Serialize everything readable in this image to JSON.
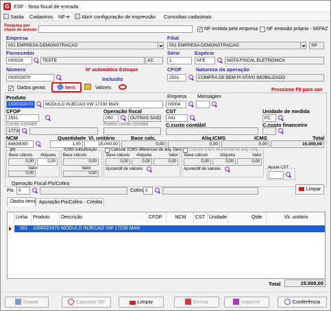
{
  "window": {
    "title": "ESF - Nota fiscal de entrada"
  },
  "menu": [
    "Saída",
    "Cadastros",
    "NF-e",
    "Abrir configuração de impressão",
    "Consultas cadastrais"
  ],
  "search": {
    "label": "Pesquisa por chave de acesso",
    "value": ""
  },
  "checks": {
    "nf_emitida_empresa": "NF emitida pela empresa",
    "nf_emissao_propria": "NF emissão própria - SEFAZ"
  },
  "empresa": {
    "label": "Empresa",
    "value": "001 EMPRESA DEMONSTRACAO"
  },
  "filial": {
    "label": "Filial",
    "value": "001 EMPRESA DEMONSTRACAO",
    "uf": "SP"
  },
  "fornecedor": {
    "label": "Fornecedor",
    "code": "000029",
    "name": "TESTE",
    "uf": "AC"
  },
  "serie": {
    "label": "Série",
    "value": "1"
  },
  "especie": {
    "label": "Espécie",
    "code": "NFE",
    "desc": "NOTA FISCAL ELETRONICA"
  },
  "numero": {
    "label": "Número",
    "value": "000003070",
    "auto_label": "Nº automático Estoque",
    "inclusao": "Inclusão"
  },
  "cfop_top": {
    "label": "CFOP",
    "value": "2551"
  },
  "natureza": {
    "label": "Natureza da operação",
    "value": "COMPRA DE BEM P/ ATIVO IMOBILIZADO"
  },
  "tabs_top": {
    "dados_gerais": "Dados gerais",
    "itens": "Itens",
    "valores": "Valores"
  },
  "hint_f8": "Pressione F8 para sair",
  "produto": {
    "label": "Produto",
    "code": "1000022470",
    "desc": "MODULO INJECAO VW 17230 MAN"
  },
  "cfop_item": {
    "label": "CFOP",
    "value": "2551"
  },
  "empresa_item": {
    "label": "Empresa",
    "value": "00004"
  },
  "mensagem": {
    "label": "Mensagem"
  },
  "operacao_fiscal": {
    "label": "Operação fiscal",
    "code": "000",
    "desc": "OUTRAS SAIDAS"
  },
  "cst": {
    "label": "CST",
    "value": "041"
  },
  "unidade": {
    "label": "Unidade de medida",
    "value": "PC"
  },
  "conta_contabil": {
    "label": "Conta contábil",
    "value": "17730"
  },
  "rateio": {
    "label": "Rateio conta contábil"
  },
  "c_custo_contabil": {
    "label": "C.custo contábil"
  },
  "c_custo_financeiro": {
    "label": "C.custo financeiro"
  },
  "ncm": {
    "label": "NCM",
    "value": "84639000"
  },
  "quantidade": {
    "label": "Quantidade",
    "value": "1,00"
  },
  "vl_unitario": {
    "label": "Vl. unitário",
    "value": "15.000,00"
  },
  "base_calc": {
    "label": "Base calc.",
    "value": "0,00"
  },
  "aliq_icms": {
    "label": "Alíq.ICMS",
    "value": "0,00"
  },
  "icms": {
    "label": "ICMS",
    "value": "0,00"
  },
  "total": {
    "label": "Total",
    "value": "15.000,00"
  },
  "ipi": {
    "label": "IPI",
    "base_label": "Base cálculo",
    "aliq_label": "Alíquota",
    "base": "0,00",
    "aliq": "0,00",
    "valor_label": "Valor",
    "valor": "0,00"
  },
  "icms_st": {
    "label": "ICMS substituição",
    "base_label": "Base cálculo",
    "aliq_label": "Alíquota",
    "base": "0,00",
    "aliq": "0,00",
    "valor_label": "Valor",
    "valor": "0,00"
  },
  "difal1": {
    "label": "Calcular ICMS diferencial de alíq. Dest.",
    "base_label": "Base cálculo",
    "aliq_label": "Alíquota",
    "valor_label": "Valor",
    "base": "0,00",
    "aliq": "0,00",
    "valor": "0,00",
    "ajuste_label": "Ajuste/dif de valores"
  },
  "difal2": {
    "label": "Calcula ICMS diferencial de alíq. Orig.",
    "base_label": "Base cálculo",
    "aliq_label": "Alíquota",
    "valor_label": "Valor",
    "base": "0,00",
    "aliq": "0,00",
    "valor": "0,00",
    "ajuste_label": "Ajuste/dif de valores"
  },
  "ajuste_cst": {
    "label": "Ajuste CST"
  },
  "pis_cofins": {
    "label": "Operação Fiscal Pis/Cofins",
    "pis": "Pis",
    "pis_code": "0",
    "cofins": "Cofins",
    "cofins_code": "0"
  },
  "limpar_item": "Limpar",
  "tabs_bottom": {
    "dados_itens": "Dados itens",
    "apuracao": "Apuração Pis/Cofins - Crédito"
  },
  "table": {
    "headers": [
      "Linha",
      "Produto",
      "Descrição",
      "CFOP",
      "NCM",
      "CST",
      "Unidade",
      "Qtde.",
      "Vlr. unitário"
    ],
    "rows": [
      [
        "001",
        "1000022470",
        "MODULO INJECAO VW 17230 MAN",
        "",
        "",
        "",
        "",
        "",
        ""
      ]
    ]
  },
  "footer_total": {
    "label": "Total",
    "value": "15.000,00"
  },
  "buttons": {
    "gravar": "Gravar",
    "cancelar": "Cancelar NF",
    "limpar": "Limpar",
    "excluir": "Excluir",
    "imprimir": "Imprimir",
    "conferencia": "Conferência"
  },
  "colors": {
    "accent": "#1e5bd8",
    "red": "#c00000",
    "blue_label": "#2a2aa8",
    "icon": "#8a2fc8"
  }
}
